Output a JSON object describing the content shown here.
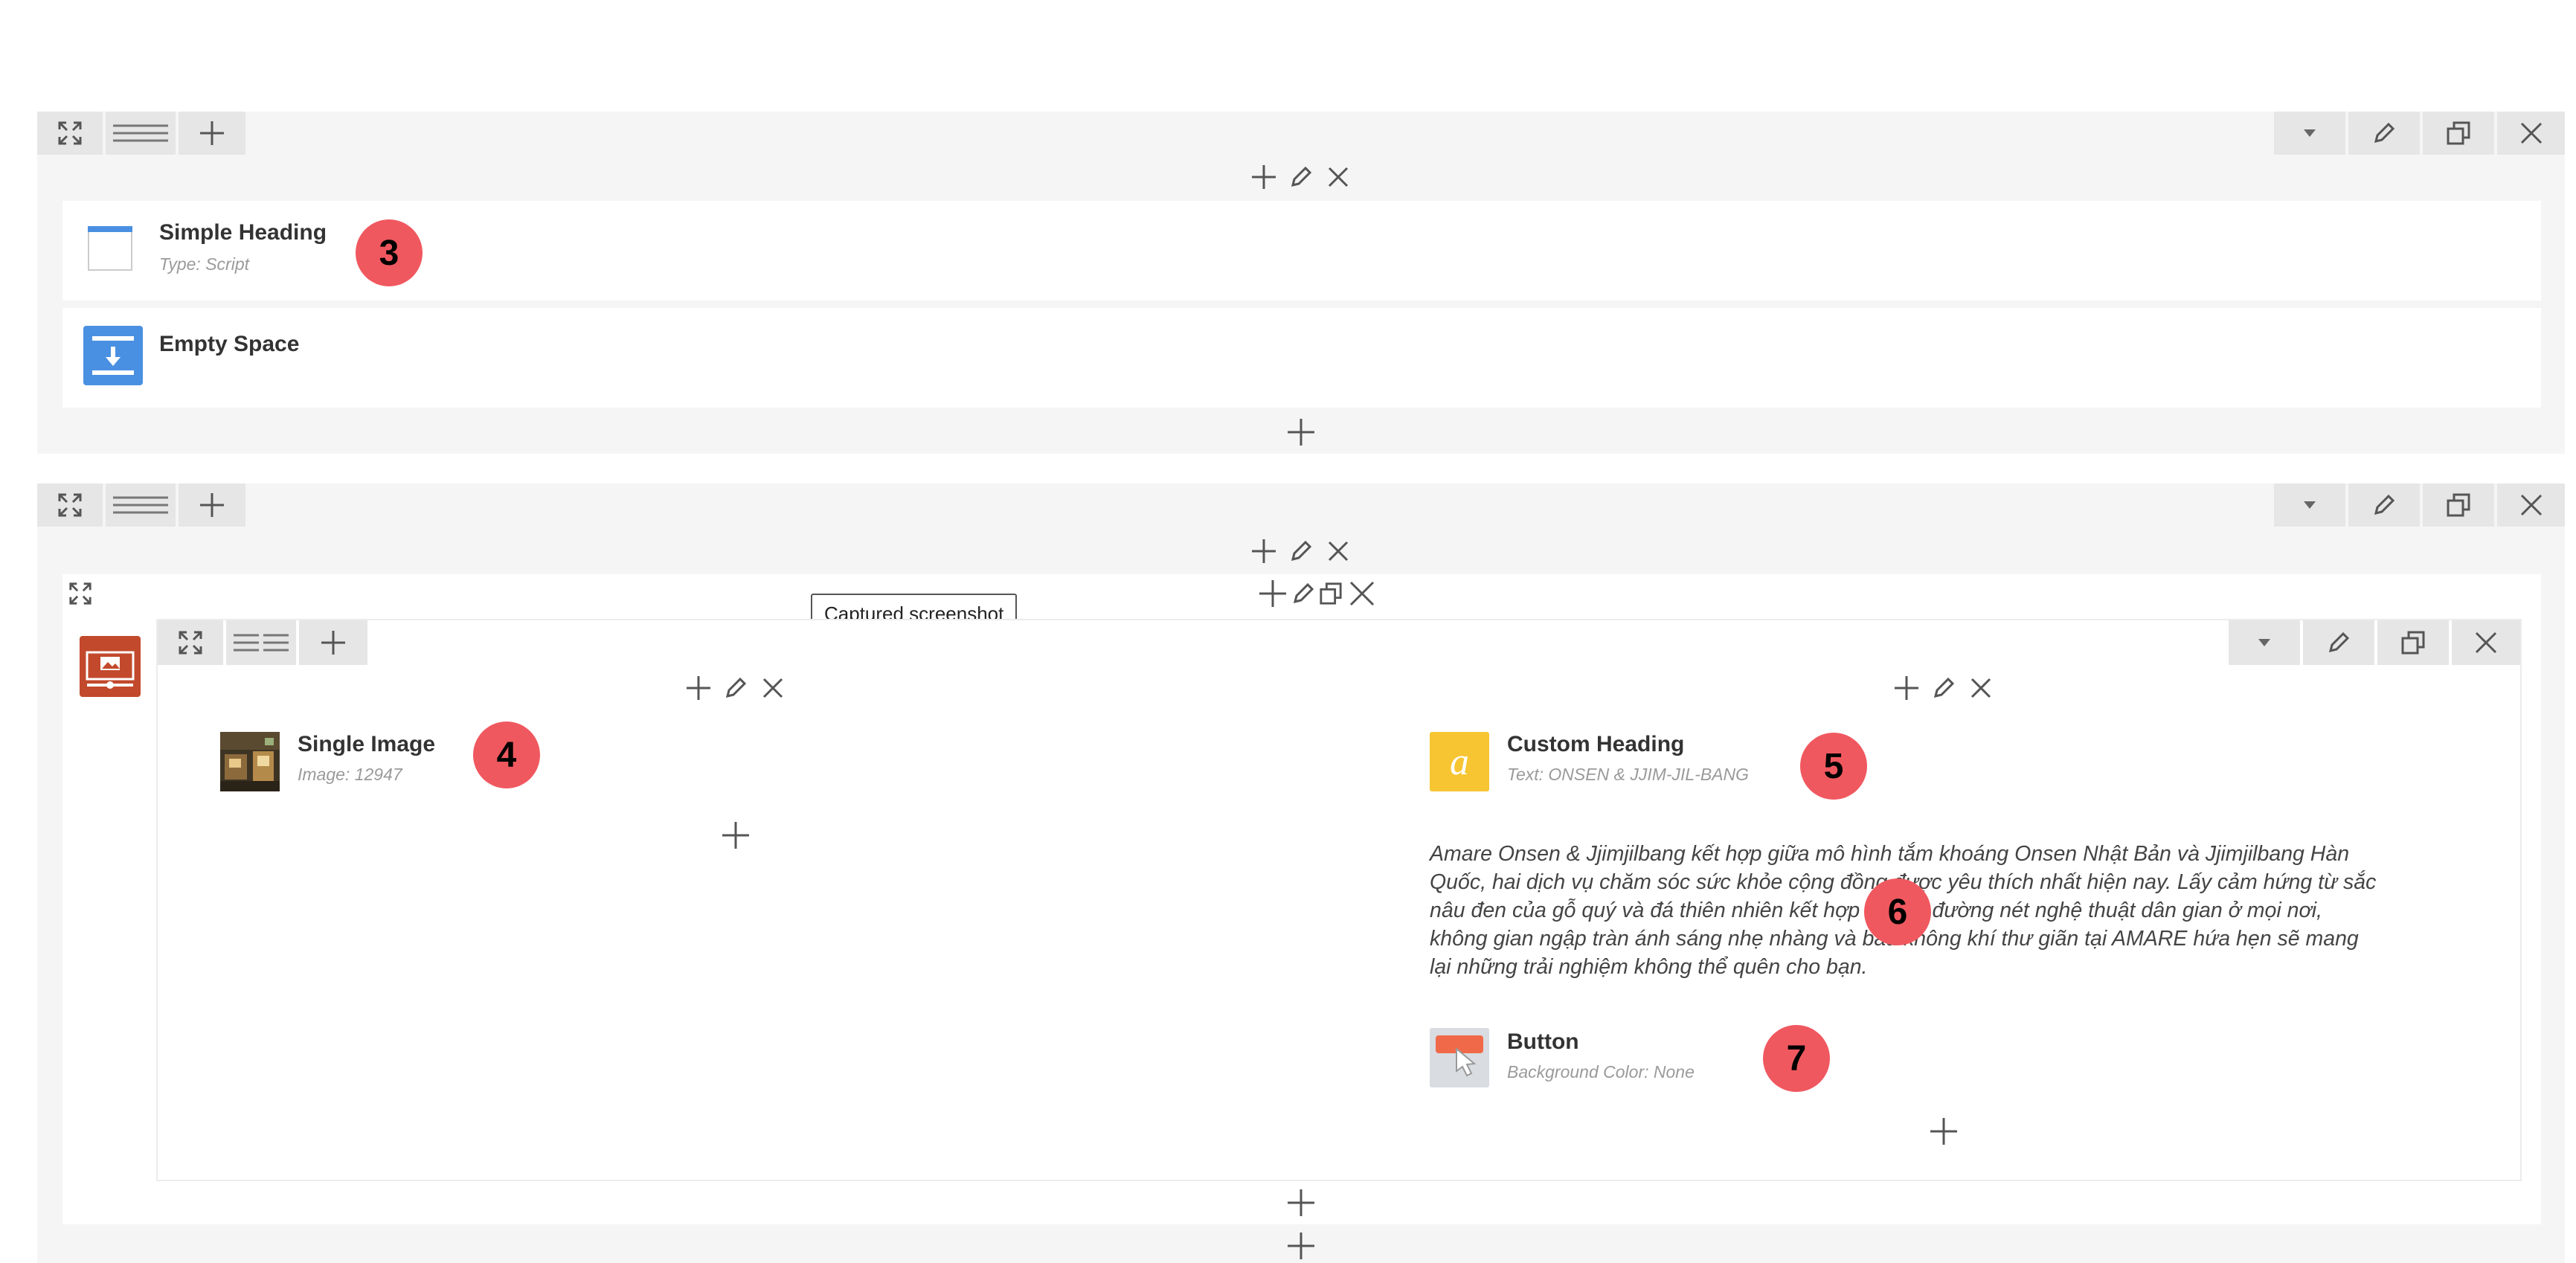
{
  "rows": {
    "row1": {
      "elements": [
        {
          "title": "Simple Heading",
          "subtitle": "Type: Script",
          "badge": "3"
        },
        {
          "title": "Empty Space"
        }
      ]
    },
    "row2": {
      "left_column": {
        "element": {
          "title": "Single Image",
          "subtitle": "Image: 12947",
          "badge": "4"
        }
      },
      "right_column": {
        "heading": {
          "title": "Custom Heading",
          "subtitle": "Text: ONSEN & JJIM-JIL-BANG",
          "badge": "5"
        },
        "text_block": {
          "lines": [
            "Amare Onsen & Jjimjilbang kết hợp giữa mô hình tắm khoáng Onsen Nhật Bản và Jjimjilbang Hàn",
            "Quốc, hai dịch vụ chăm sóc sức khỏe cộng đồng được yêu thích nhất hiện nay. Lấy cảm hứng từ sắc",
            "nâu đen của gỗ quý và đá thiên nhiên kết hợp những đường nét nghệ thuật dân gian ở mọi nơi,",
            "không gian ngập tràn ánh sáng nhẹ nhàng và bầu không khí thư giãn tại AMARE hứa hẹn sẽ mang",
            "lại những trải nghiệm không thể quên cho bạn."
          ],
          "badge": "6"
        },
        "button": {
          "title": "Button",
          "subtitle": "Background Color: None",
          "badge": "7"
        }
      }
    }
  },
  "tooltip": "Captured screenshot",
  "colors": {
    "panel": "#f5f5f5",
    "control_button": "#e6e6e6",
    "badge": "#f0585f",
    "accent_blue": "#4a90e2",
    "heading_icon_yellow": "#f6c531",
    "section_icon": "#c2492b"
  }
}
